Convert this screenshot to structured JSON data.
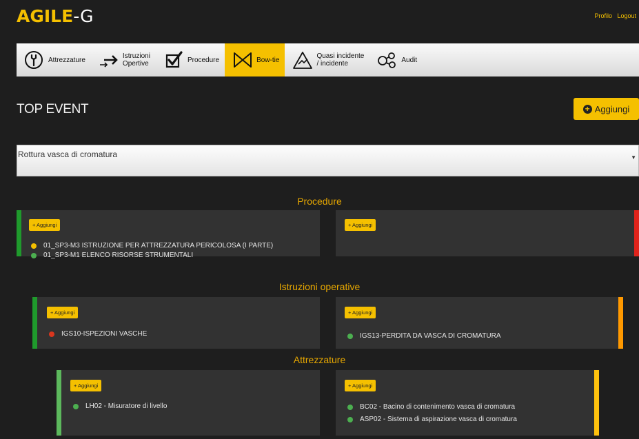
{
  "header": {
    "logo_part1": "AGILE",
    "logo_part2": "-G",
    "links": [
      "Profilo",
      "Logout"
    ]
  },
  "nav": [
    {
      "icon": "spanner-icon",
      "label": "Attrezzature",
      "active": false
    },
    {
      "icon": "arrows-right-icon",
      "label": "Istruzioni\nOpertive",
      "active": false
    },
    {
      "icon": "checkbox-icon",
      "label": "Procedure",
      "active": false
    },
    {
      "icon": "bowtie-icon",
      "label": "Bow-tie",
      "active": true
    },
    {
      "icon": "warning-triangle-icon",
      "label": "Quasi incidente\n/ incidente",
      "active": false
    },
    {
      "icon": "network-nodes-icon",
      "label": "Audit",
      "active": false
    }
  ],
  "page": {
    "title": "TOP EVENT",
    "add_label": "Aggiungi",
    "top_event_value": "Rottura vasca di cromatura"
  },
  "add_small_label": "+ Aggiungi",
  "colors": {
    "accent": "#f5c000",
    "green": "#1f9a2c",
    "light_green": "#5cb85c",
    "red": "#e0231b",
    "orange": "#ff9900",
    "yellow": "#ffc20e",
    "dot_yellow": "#f5c000",
    "dot_green": "#4caf50",
    "dot_red": "#d9361e"
  },
  "sections": [
    {
      "title": "Procedure",
      "left": {
        "bar_color": "green",
        "items": [
          {
            "status": "yellow",
            "text": "01_SP3-M3 ISTRUZIONE PER ATTREZZATURA PERICOLOSA (I PARTE)"
          },
          {
            "status": "green",
            "text": "01_SP3-M1 ELENCO RISORSE STRUMENTALI"
          }
        ]
      },
      "right": {
        "bar_color": "red",
        "items": []
      }
    },
    {
      "title": "Istruzioni operative",
      "left": {
        "bar_color": "green",
        "items": [
          {
            "status": "red",
            "text": "IGS10-ISPEZIONI VASCHE"
          }
        ]
      },
      "right": {
        "bar_color": "orange",
        "items": [
          {
            "status": "green",
            "text": "IGS13-PERDITA DA VASCA DI CROMATURA"
          }
        ]
      }
    },
    {
      "title": "Attrezzature",
      "left": {
        "bar_color": "light_green",
        "items": [
          {
            "status": "green",
            "text": "LH02 - Misuratore di livello"
          }
        ]
      },
      "right": {
        "bar_color": "yellow",
        "items": [
          {
            "status": "green",
            "text": "BC02 - Bacino di contenimento vasca di cromatura"
          },
          {
            "status": "green",
            "text": "ASP02 - Sistema di aspirazione vasca di cromatura"
          }
        ]
      }
    }
  ]
}
